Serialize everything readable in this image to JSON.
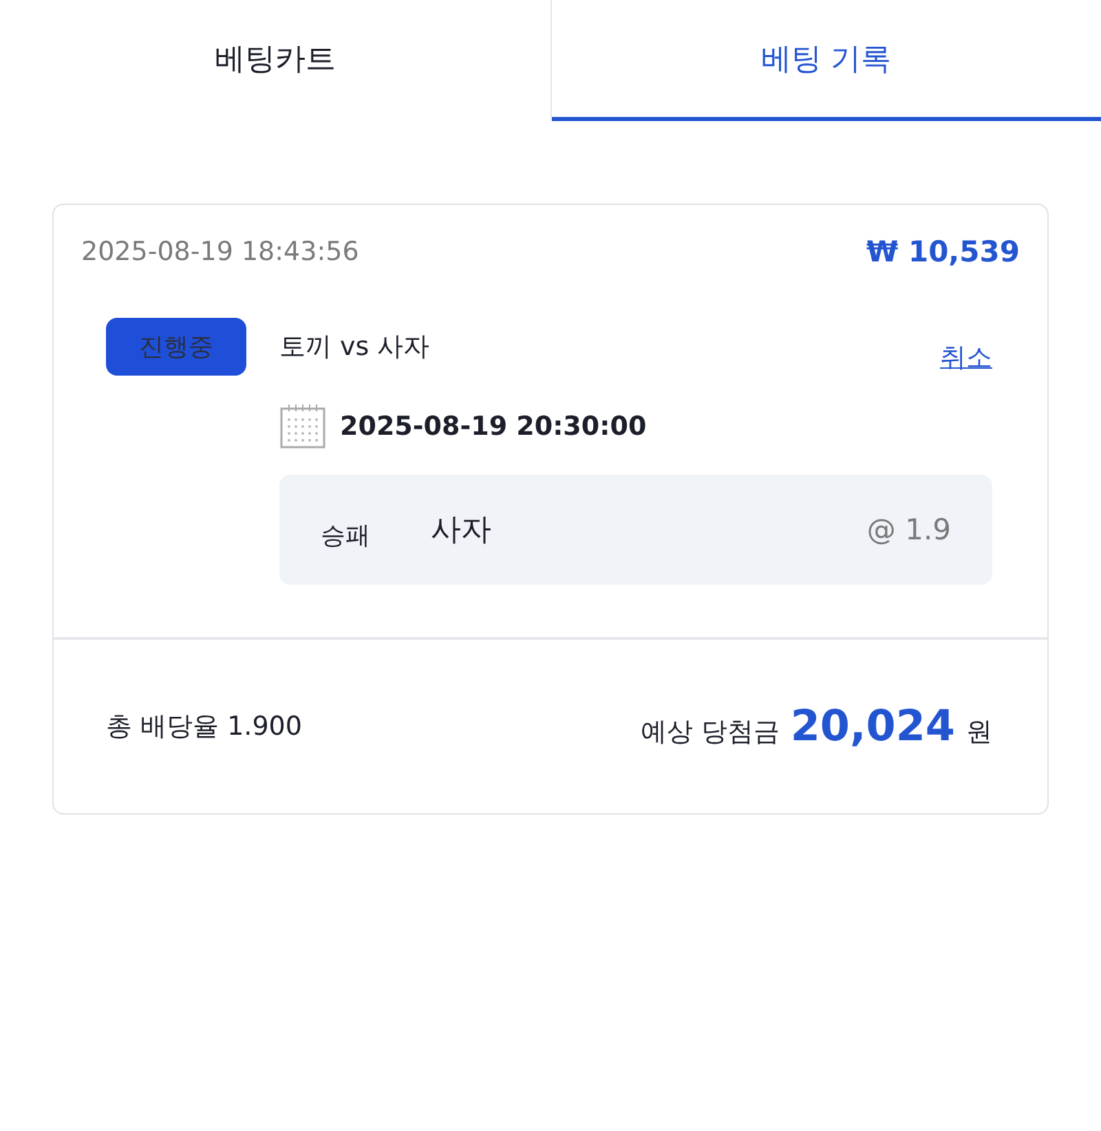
{
  "tabs": [
    {
      "label": "베팅카트",
      "selected": false
    },
    {
      "label": "베팅 기록",
      "selected": true
    }
  ],
  "bet": {
    "placed_at": "2025-08-19 18:43:56",
    "stake": "₩ 10,539",
    "selections": [
      {
        "status": "진행중",
        "match": "토끼 vs 사자",
        "cancel": "취소",
        "kickoff": "2025-08-19 20:30:00",
        "market": "승패",
        "pick": "사자",
        "odds": "@ 1.9"
      }
    ],
    "total_odds_label": "총 배당율 1.900",
    "payout_label": "예상 당첨금",
    "payout": "20,024",
    "currency": "원"
  }
}
